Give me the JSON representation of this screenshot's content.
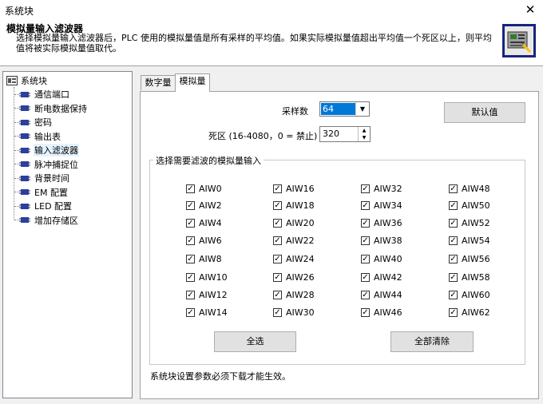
{
  "window": {
    "title": "系统块",
    "close_glyph": "✕"
  },
  "header": {
    "title": "模拟量输入滤波器",
    "description": "选择模拟量输入滤波器后，PLC 使用的模拟量值是所有采样的平均值。如果实际模拟量值超出平均值一个死区以上，则平均值将被实际模拟量值取代。",
    "icon": "analog-filter-module-icon"
  },
  "tree": {
    "root_label": "系统块",
    "items": [
      {
        "label": "通信端口"
      },
      {
        "label": "断电数据保持"
      },
      {
        "label": "密码"
      },
      {
        "label": "输出表"
      },
      {
        "label": "输入滤波器",
        "selected": true
      },
      {
        "label": "脉冲捕捉位"
      },
      {
        "label": "背景时间"
      },
      {
        "label": "EM 配置"
      },
      {
        "label": "LED 配置"
      },
      {
        "label": "增加存储区"
      }
    ]
  },
  "tabs": [
    {
      "label": "数字量",
      "active": false
    },
    {
      "label": "模拟量",
      "active": true
    }
  ],
  "settings": {
    "samples_label": "采样数",
    "samples_value": "64",
    "deadband_label": "死区 (16-4080，0 = 禁止)",
    "deadband_value": "320",
    "default_button": "默认值"
  },
  "group": {
    "title": "选择需要滤波的模拟量输入",
    "channels": [
      [
        "AIW0",
        "AIW2",
        "AIW4",
        "AIW6",
        "AIW8",
        "AIW10",
        "AIW12",
        "AIW14"
      ],
      [
        "AIW16",
        "AIW18",
        "AIW20",
        "AIW22",
        "AIW24",
        "AIW26",
        "AIW28",
        "AIW30"
      ],
      [
        "AIW32",
        "AIW34",
        "AIW36",
        "AIW38",
        "AIW40",
        "AIW42",
        "AIW44",
        "AIW46"
      ],
      [
        "AIW48",
        "AIW50",
        "AIW52",
        "AIW54",
        "AIW56",
        "AIW58",
        "AIW60",
        "AIW62"
      ]
    ],
    "checked": true,
    "select_all_button": "全选",
    "clear_all_button": "全部清除"
  },
  "footer": {
    "note": "系统块设置参数必须下载才能生效。"
  },
  "colors": {
    "selection": "#0078d7",
    "icon_border": "#1a237e",
    "chip": "#2b3f9e"
  }
}
